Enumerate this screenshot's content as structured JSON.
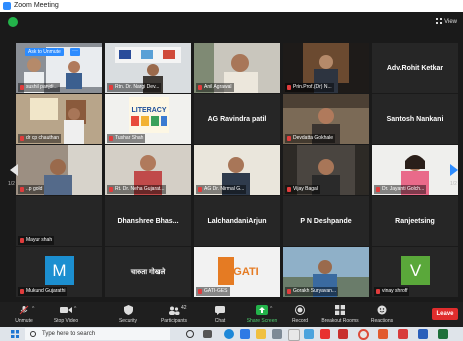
{
  "window": {
    "title": "Zoom Meeting"
  },
  "header": {
    "view_label": "View"
  },
  "pagination": {
    "left": "1/2",
    "right": "1/2"
  },
  "tiles": [
    {
      "id": "t0",
      "label": "sushil panjdi..."
    },
    {
      "id": "t1",
      "label": "Rtn. Dr. Nargi Dev..."
    },
    {
      "id": "t2",
      "label": "Anil Agrawal"
    },
    {
      "id": "t3",
      "label": "Prin.Prof.(Dr) N..."
    },
    {
      "id": "t4",
      "name": "Adv.Rohit Ketkar"
    },
    {
      "id": "t5",
      "label": "dr cp chauthan"
    },
    {
      "id": "t6",
      "label": "Tushar Shah",
      "poster_text": "LITERACY"
    },
    {
      "id": "t7",
      "name": "AG Ravindra patil"
    },
    {
      "id": "t8",
      "label": "Devdatta Gokhale"
    },
    {
      "id": "t9",
      "name": "Santosh Nankani"
    },
    {
      "id": "t10",
      "label": "..p gold"
    },
    {
      "id": "t11",
      "label": "Rt. Dr. Neha Gujarat..."
    },
    {
      "id": "t12",
      "label": "AG Dr. Nirmal G..."
    },
    {
      "id": "t13",
      "label": "Vijay Bagal"
    },
    {
      "id": "t14",
      "label": "Dr. Jayanti Golch..."
    },
    {
      "id": "t15",
      "label": "Mayur shah"
    },
    {
      "id": "t16",
      "name": "Dhanshree Bhas..."
    },
    {
      "id": "t17",
      "name": "LalchandaniArjun"
    },
    {
      "id": "t18",
      "name": "P N Deshpande"
    },
    {
      "id": "t19",
      "name": "Ranjeetsing"
    },
    {
      "id": "t20",
      "label": "Mukund Gujarathi",
      "avatar": "M",
      "avatar_color": "#1c8fd0"
    },
    {
      "id": "t21",
      "name": "चारुता गोखले"
    },
    {
      "id": "t22",
      "label": "GATI-GES",
      "logo_text": "GATI"
    },
    {
      "id": "t23",
      "label": "Gorakh Suryavan..."
    },
    {
      "id": "t24",
      "label": "vinay shroff",
      "avatar": "V",
      "avatar_color": "#5aa83a"
    }
  ],
  "notice": {
    "unmute": "Ask to Unmute"
  },
  "toolbar": {
    "unmute": "Unmute",
    "stop_video": "Stop Video",
    "security": "Security",
    "participants": "Participants",
    "participants_count": "42",
    "chat": "Chat",
    "share_screen": "Share Screen",
    "record": "Record",
    "breakout": "Breakout Rooms",
    "reactions": "Reactions",
    "leave": "Leave"
  },
  "taskbar": {
    "search_placeholder": "Type here to search"
  },
  "colors": {
    "accent": "#2d8cff",
    "active_speaker": "#d6e43a",
    "leave": "#e02d2d",
    "share": "#23b34a"
  }
}
